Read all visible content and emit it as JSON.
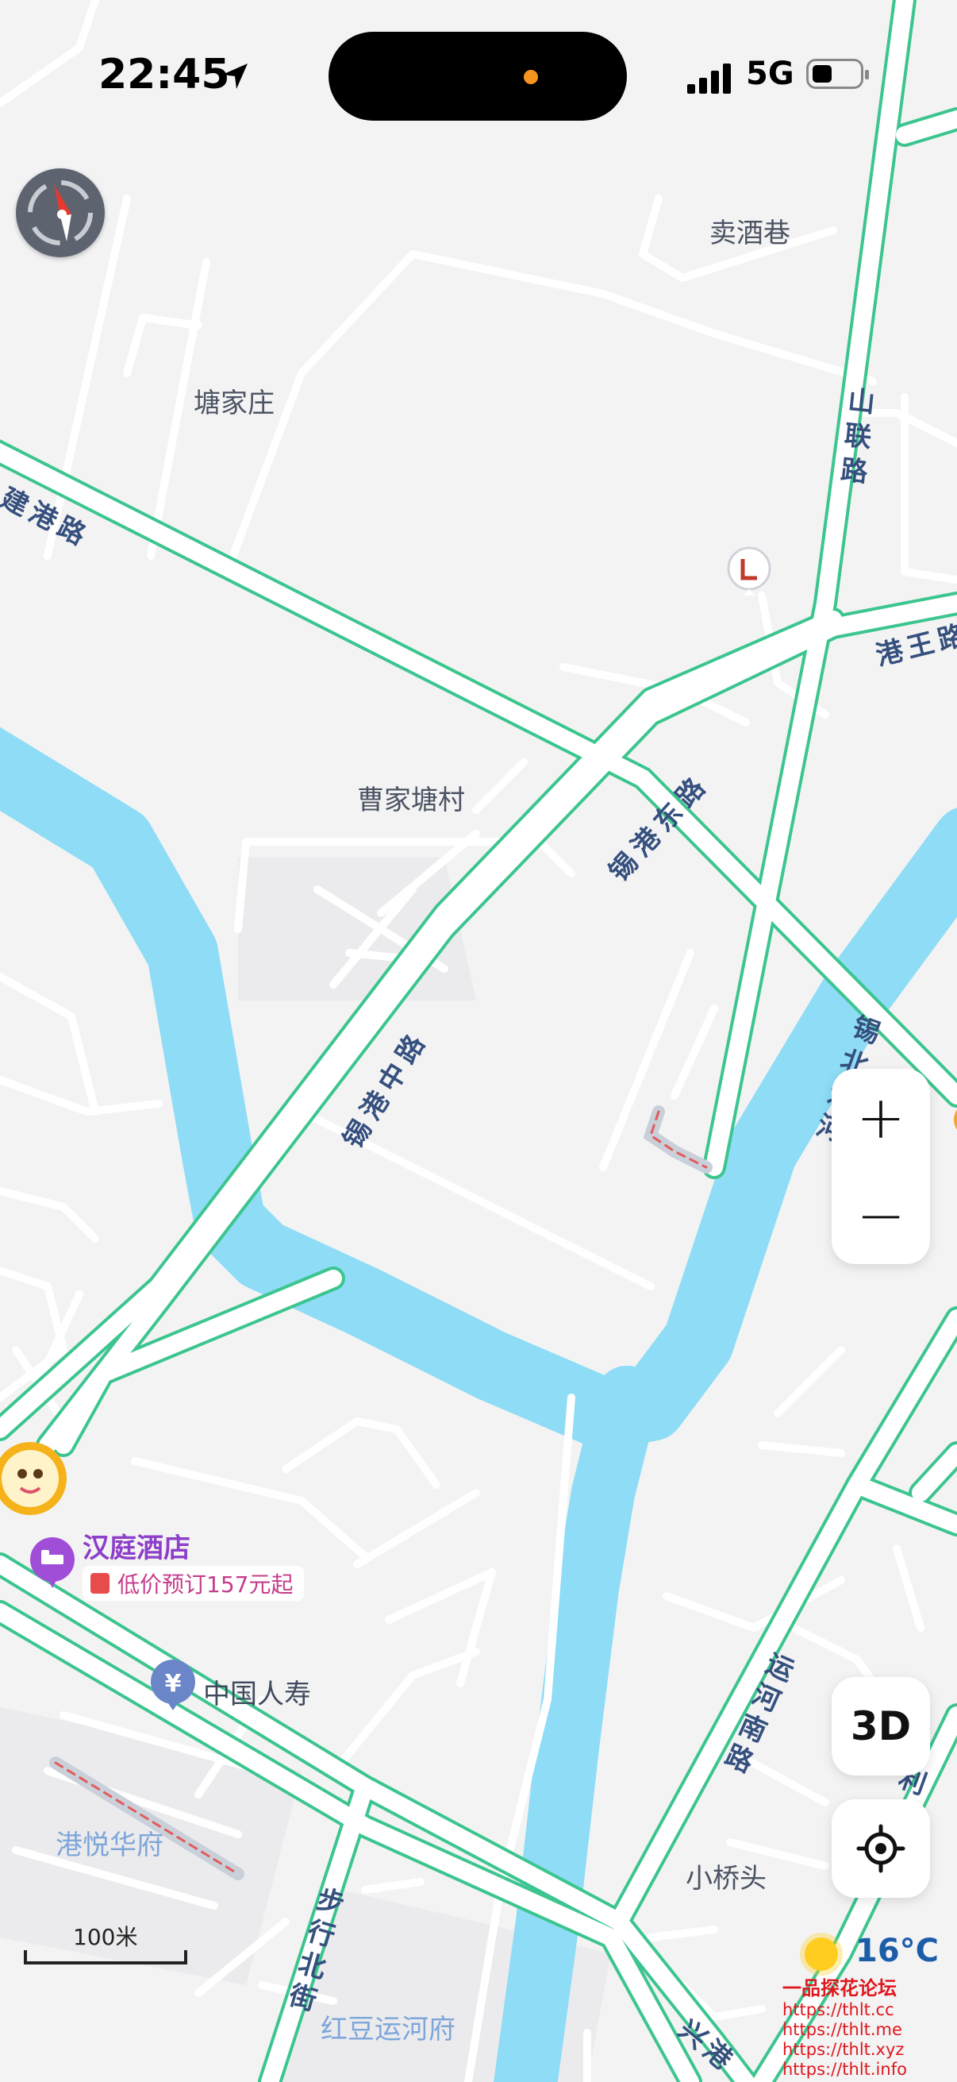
{
  "status_bar": {
    "time": "22:45",
    "network": "5G"
  },
  "map": {
    "place_labels": {
      "maijiuxiang": "卖酒巷",
      "tangjiazhuang": "塘家庄",
      "caojiatangcun": "曹家塘村",
      "xiaoqiaotou": "小桥头",
      "gangyuehuafu": "港悦华府",
      "hongdouyunhefu": "红豆运河府"
    },
    "road_labels": {
      "jiangang": "建港路",
      "shanlian": "山联路",
      "gangwang": "港王路",
      "xigangdong": "锡港东路",
      "xigangzhong": "锡港中路",
      "xibeiyunhe": "锡北运河",
      "yunhenan": "运河南路",
      "buxingbei": "步行北街",
      "li_fragment": "利",
      "bottom_fragment": "兴港"
    },
    "pois": {
      "hotel_name": "汉庭酒店",
      "hotel_deal": "低价预订157元起",
      "insurance_name": "中国人寿"
    },
    "scale_label": "100米"
  },
  "controls": {
    "zoom_in": "+",
    "zoom_out": "−",
    "three_d": "3D"
  },
  "weather": {
    "temperature": "16°C"
  },
  "watermark": {
    "title": "一品探花论坛",
    "links": [
      "https://thlt.cc",
      "https://thlt.me",
      "https://thlt.xyz",
      "https://thlt.info"
    ]
  }
}
